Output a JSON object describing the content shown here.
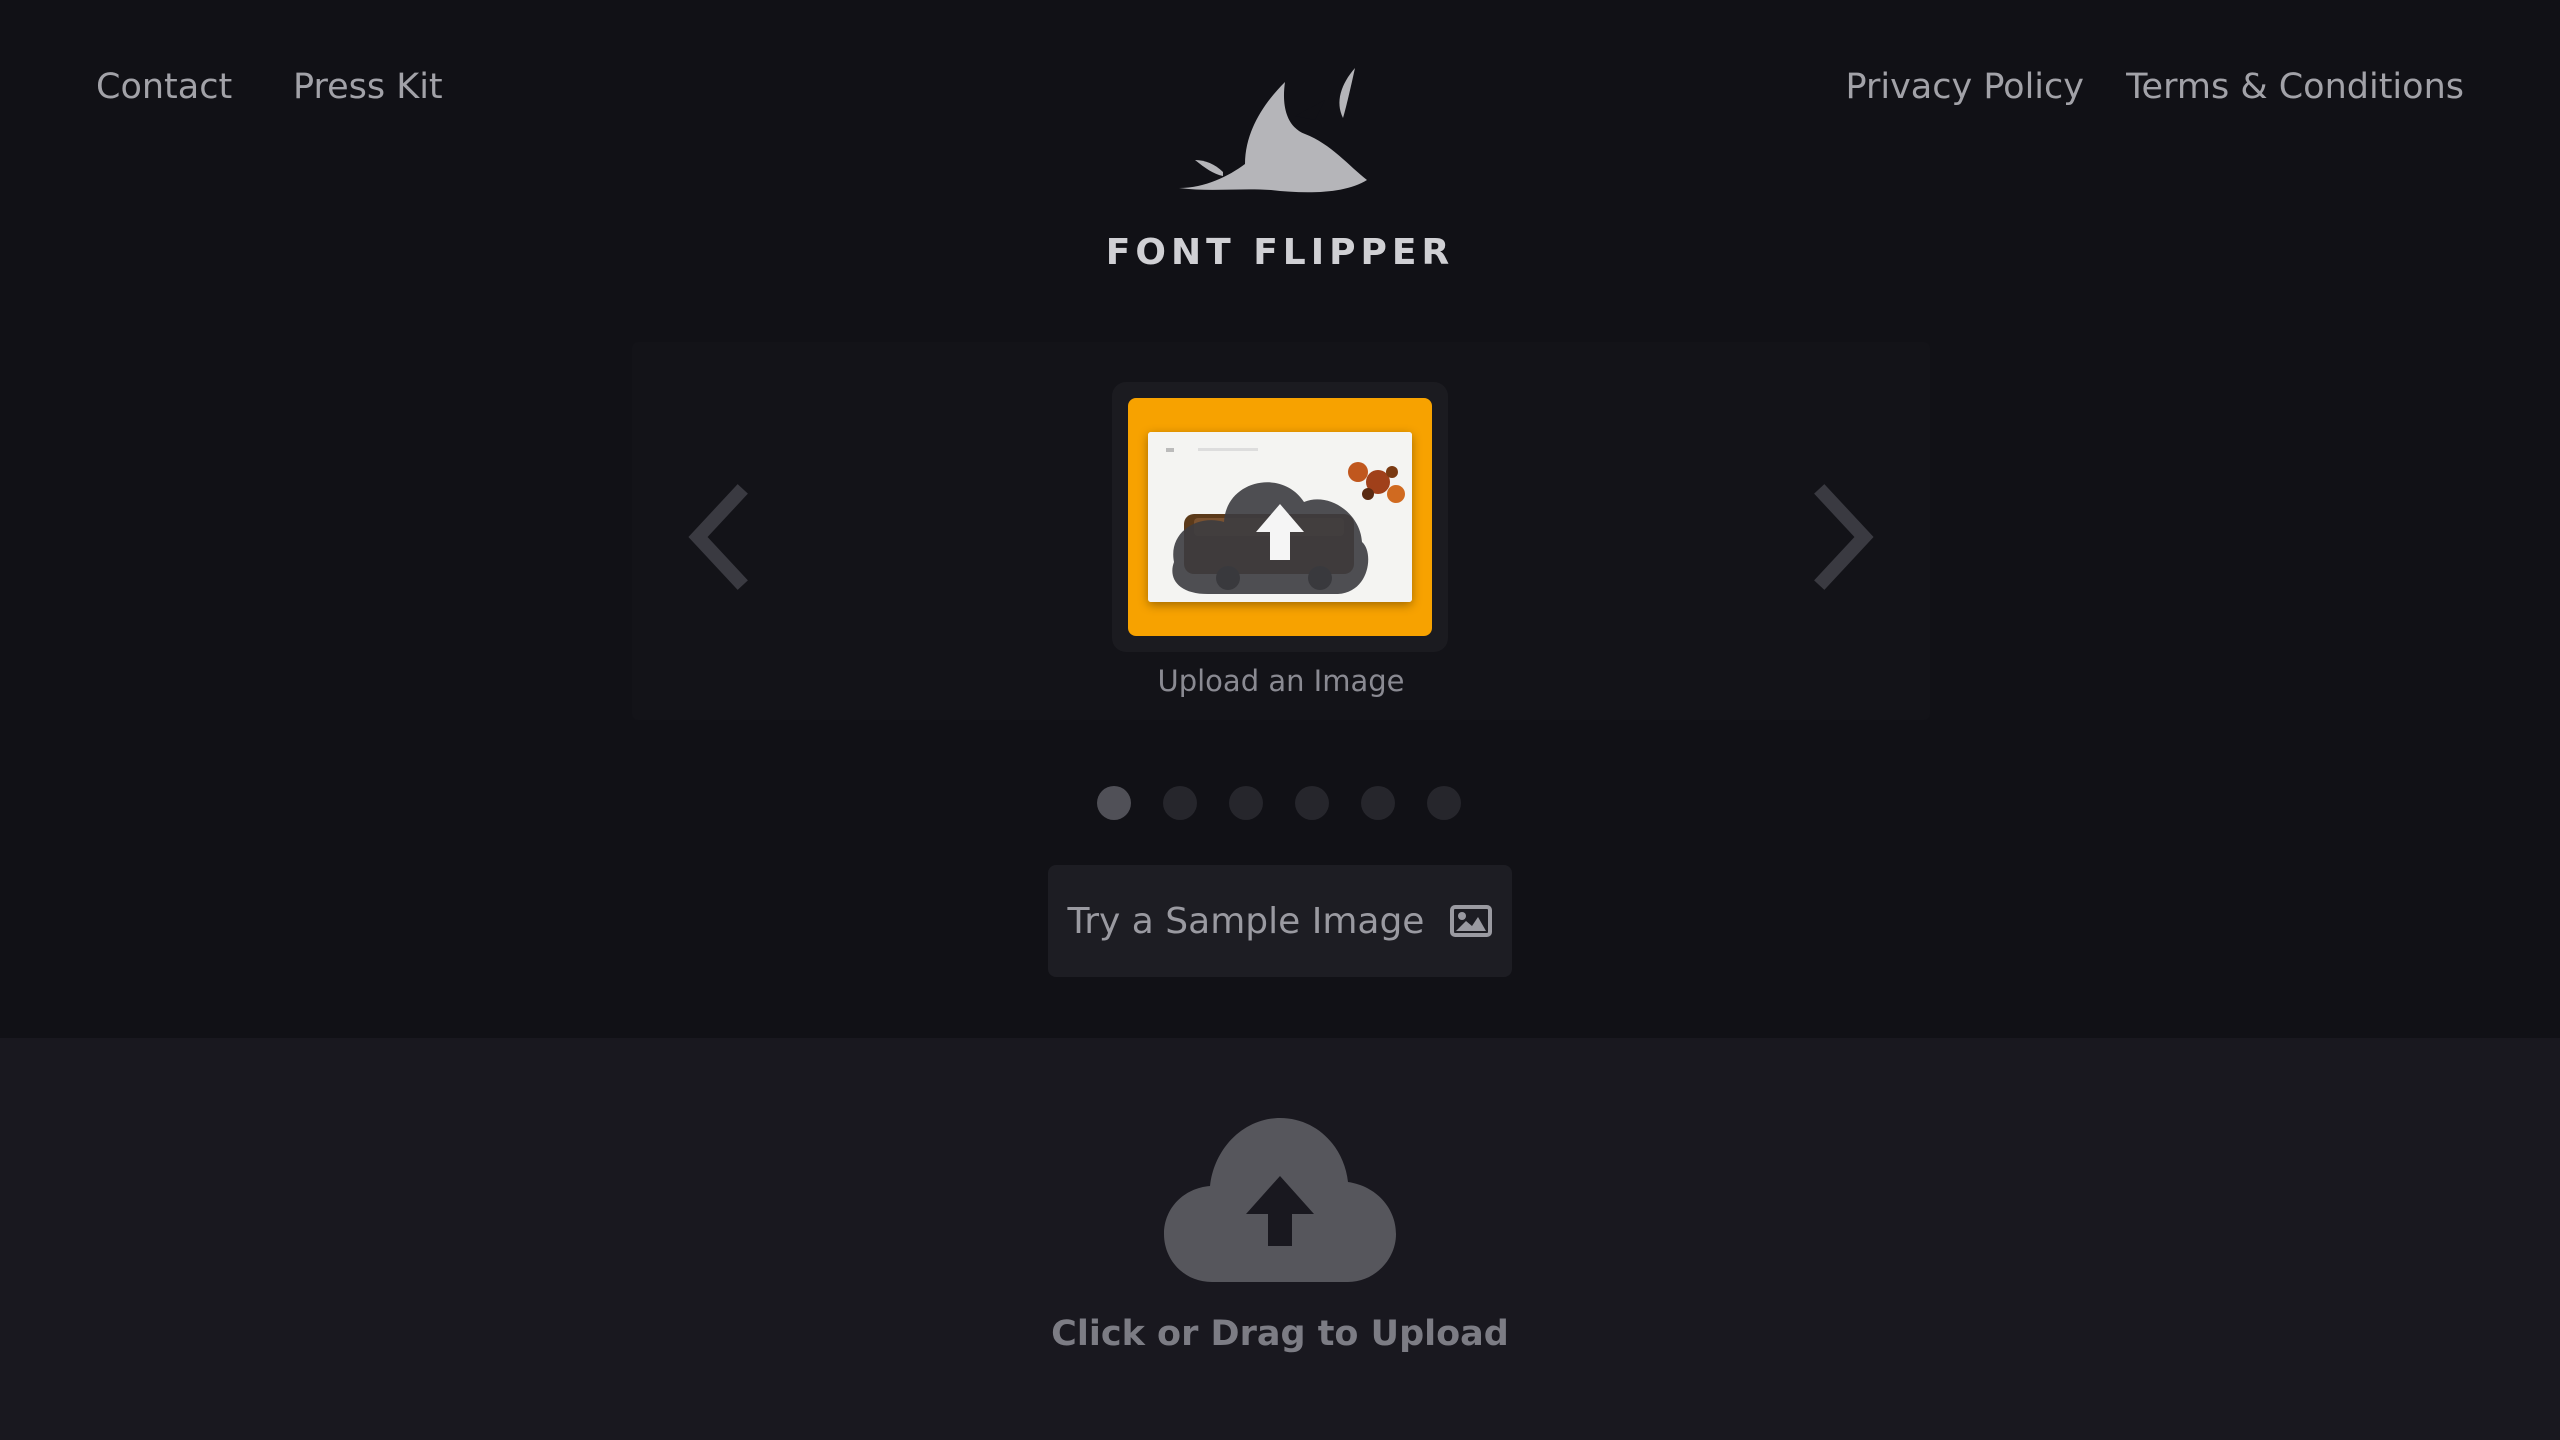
{
  "nav": {
    "contact": "Contact",
    "press_kit": "Press Kit",
    "privacy": "Privacy Policy",
    "terms": "Terms & Conditions"
  },
  "brand": {
    "name": "FONT FLIPPER",
    "logo_icon": "shark-logo-icon"
  },
  "carousel": {
    "caption": "Upload an Image",
    "prev_icon": "chevron-left-icon",
    "next_icon": "chevron-right-icon",
    "slide_count": 6,
    "active_index": 0
  },
  "sample_button": {
    "label": "Try a Sample Image",
    "icon": "image-icon"
  },
  "upload": {
    "label": "Click or Drag to Upload",
    "icon": "cloud-upload-icon"
  },
  "colors": {
    "background": "#111116",
    "upload_zone": "#19181f",
    "accent": "#f7a200"
  }
}
